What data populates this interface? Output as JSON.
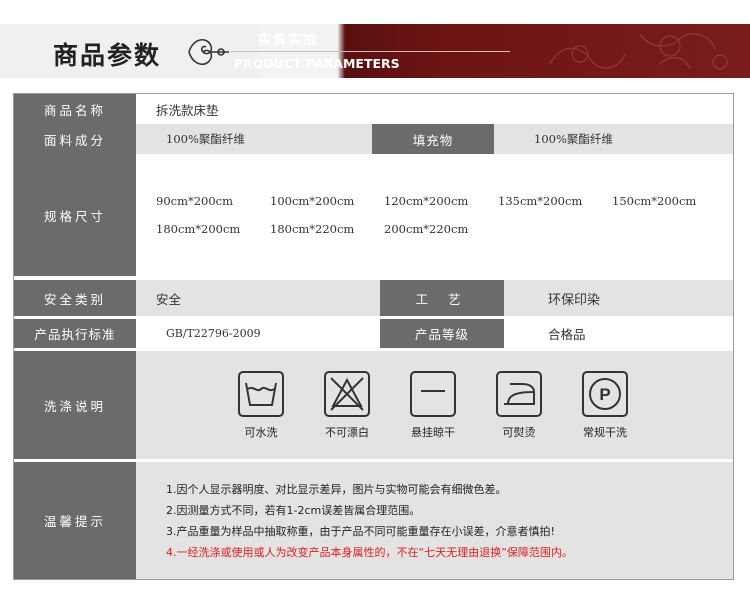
{
  "banner": {
    "title": "商品参数",
    "subtitle_cn": "实景实拍",
    "subtitle_en": "PRODUCT PARAMETERS"
  },
  "table": {
    "row1": {
      "label": "商品名称",
      "value": "拆洗款床垫"
    },
    "row2": {
      "label": "面料成分",
      "value": "100%聚酯纤维",
      "label2": "填充物",
      "value2": "100%聚酯纤维"
    },
    "row3": {
      "label": "规格尺寸",
      "sizes": [
        "90cm*200cm",
        "100cm*200cm",
        "120cm*200cm",
        "135cm*200cm",
        "150cm*200cm",
        "180cm*200cm",
        "180cm*220cm",
        "200cm*220cm"
      ]
    },
    "row4": {
      "label": "安全类别",
      "value": "安全",
      "label2": "工 艺",
      "value2": "环保印染"
    },
    "row5": {
      "label": "产品执行标准",
      "value": "GB/T22796-2009",
      "label2": "产品等级",
      "value2": "合格品"
    },
    "row6": {
      "label": "洗涤说明",
      "items": [
        {
          "icon": "washable-icon",
          "label": "可水洗"
        },
        {
          "icon": "no-bleach-icon",
          "label": "不可漂白"
        },
        {
          "icon": "hang-dry-icon",
          "label": "悬挂晾干"
        },
        {
          "icon": "iron-icon",
          "label": "可熨烫"
        },
        {
          "icon": "dry-clean-icon",
          "label": "常规干洗"
        }
      ]
    },
    "row7": {
      "label": "温馨提示",
      "tips": [
        "1.因个人显示器明度、对比显示差异，图片与实物可能会有细微色差。",
        "2.因测量方式不同，若有1-2cm误差皆属合理范围。",
        "3.产品重量为样品中抽取称重，由于产品不同可能重量存在小误差，介意者慎拍!",
        "4.一经洗涤或使用或人为改变产品本身属性的，不在“七天无理由退换”保障范围内。"
      ]
    }
  },
  "colors": {
    "header_bg": "#6b6b6b",
    "banner_red": "#6e1414",
    "tip_red": "#e02020"
  }
}
